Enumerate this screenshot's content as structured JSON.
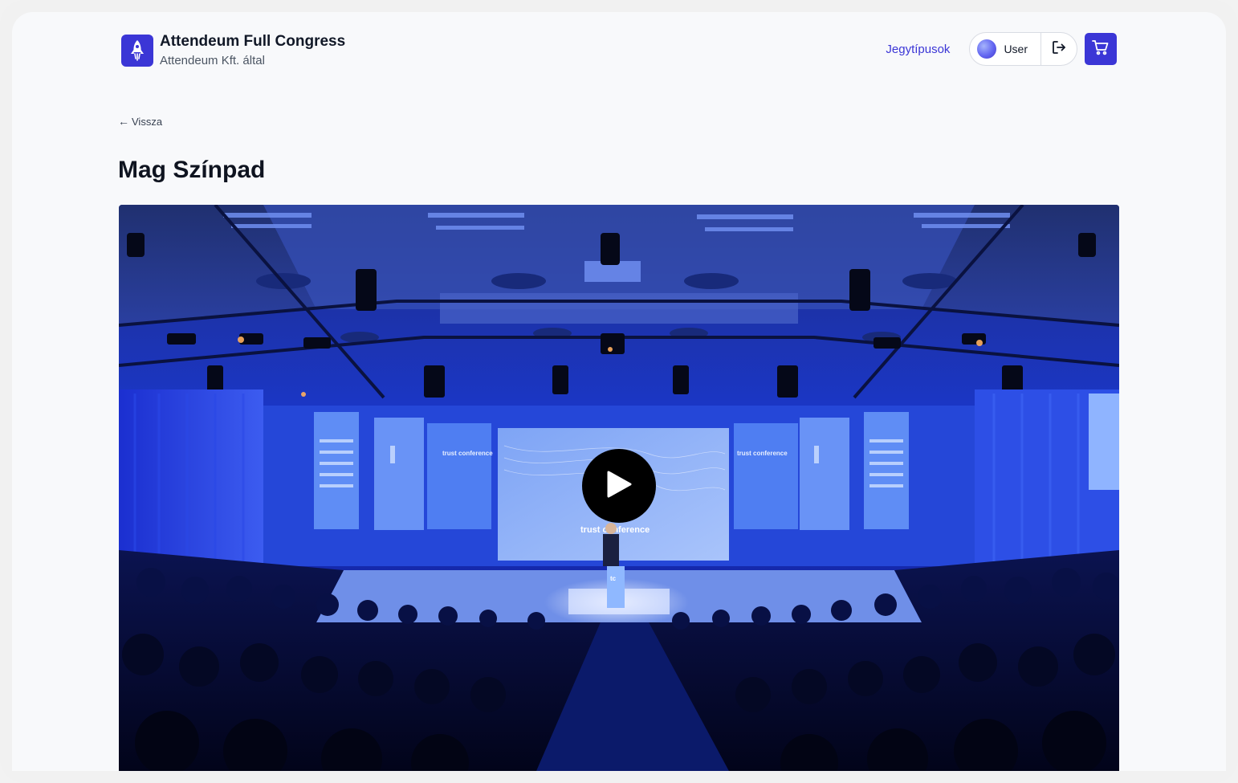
{
  "header": {
    "title": "Attendeum Full Congress",
    "subtitle": "Attendeum Kft. által",
    "nav_link": "Jegytípusok",
    "user_label": "User",
    "logo_icon": "rocket-icon",
    "logout_icon": "logout-icon",
    "cart_icon": "cart-icon"
  },
  "back": {
    "arrow": "←",
    "label": "Vissza"
  },
  "main": {
    "title": "Mag Színpad"
  },
  "video": {
    "play_icon": "play-icon",
    "screen_text": "trust conference",
    "side_panel_text": "trust conference",
    "podium_text": "tc"
  },
  "colors": {
    "accent": "#3b36d6",
    "hall_blue": "#1b2fd0"
  }
}
